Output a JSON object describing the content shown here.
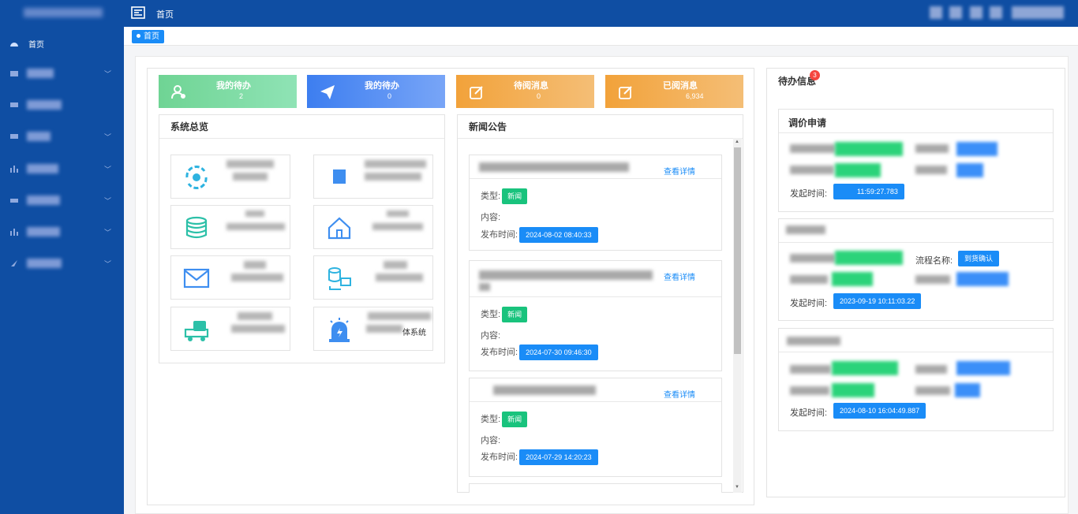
{
  "header": {
    "title": "首页"
  },
  "sidebar": {
    "items": [
      {
        "label": "首页",
        "active": true,
        "icon": "dashboard-icon"
      },
      {
        "label": "",
        "icon": "grid-icon"
      },
      {
        "label": "",
        "icon": "shield-icon"
      },
      {
        "label": "",
        "icon": "grid-icon"
      },
      {
        "label": "",
        "icon": "bar-chart-icon"
      },
      {
        "label": "",
        "icon": "grid-icon"
      },
      {
        "label": "",
        "icon": "bar-chart-icon"
      },
      {
        "label": "",
        "icon": "arrow-icon"
      }
    ]
  },
  "breadcrumb": {
    "home": "首页"
  },
  "stats": [
    {
      "title": "我的待办",
      "value": "2",
      "color": "#7ed6a2"
    },
    {
      "title": "我的待办",
      "value": "0",
      "color": "#5b8ff5"
    },
    {
      "title": "待阅消息",
      "value": "0",
      "color": "#f3a947"
    },
    {
      "title": "已阅消息",
      "value": "6,934",
      "color": "#f3a947"
    }
  ],
  "overview": {
    "title": "系统总览",
    "tiles": [
      {
        "name": ""
      },
      {
        "name": ""
      },
      {
        "name": ""
      },
      {
        "name": ""
      },
      {
        "name": ""
      },
      {
        "name": ""
      },
      {
        "name": ""
      },
      {
        "name": "体系统"
      }
    ]
  },
  "news": {
    "title": "新闻公告",
    "type_label": "类型:",
    "content_label": "内容:",
    "time_label": "发布时间:",
    "detail_link": "查看详情",
    "items": [
      {
        "tag": "新闻",
        "time": "2024-08-02 08:40:33"
      },
      {
        "tag": "新闻",
        "time": "2024-07-30 09:46:30"
      },
      {
        "tag": "新闻",
        "time": "2024-07-29 14:20:23"
      }
    ]
  },
  "todo": {
    "title": "待办信息",
    "badge": "3",
    "cards": [
      {
        "title": "调价申请",
        "start_label": "发起时间:",
        "start_time": "11:59:27.783"
      },
      {
        "title": "",
        "flow_label": "流程名称:",
        "flow_tag": "到货确认",
        "start_label": "发起时间:",
        "start_time": "2023-09-19 10:11:03.22"
      },
      {
        "title": "",
        "start_label": "发起时间:",
        "start_time": "2024-08-10 16:04:49.887"
      }
    ]
  }
}
